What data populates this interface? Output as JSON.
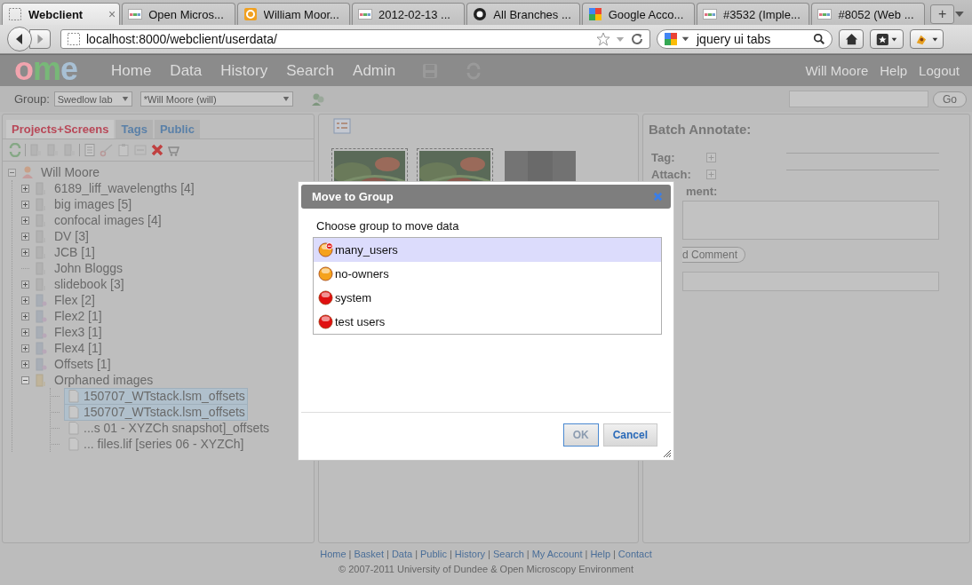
{
  "browser": {
    "tabs": [
      {
        "label": "Webclient",
        "kind": "blank",
        "selected": true
      },
      {
        "label": "Open Micros...",
        "kind": "ome",
        "selected": false
      },
      {
        "label": "William Moor...",
        "kind": "mail",
        "selected": false
      },
      {
        "label": "2012-02-13 ...",
        "kind": "ome",
        "selected": false
      },
      {
        "label": "All Branches ...",
        "kind": "github",
        "selected": false
      },
      {
        "label": "Google Acco...",
        "kind": "google",
        "selected": false
      },
      {
        "label": "#3532 (Imple...",
        "kind": "ome",
        "selected": false
      },
      {
        "label": "#8052 (Web ...",
        "kind": "ome",
        "selected": false
      }
    ],
    "tab_close": "×",
    "new_tab": "+",
    "address": "localhost:8000/webclient/userdata/",
    "search": {
      "value": "jquery ui tabs"
    }
  },
  "header": {
    "logo": [
      {
        "text": "o",
        "color": "#f2a4ae"
      },
      {
        "text": "m",
        "color": "#78b878"
      },
      {
        "text": "e",
        "color": "#a8c0d4"
      }
    ],
    "nav": [
      "Home",
      "Data",
      "History",
      "Search",
      "Admin"
    ],
    "user_links": [
      "Will Moore",
      "Help",
      "Logout"
    ]
  },
  "group_bar": {
    "label": "Group:",
    "group": "Swedlow lab",
    "user": "*Will Moore (will)",
    "go": "Go"
  },
  "left_panel": {
    "tabs": [
      {
        "label": "Projects+Screens",
        "selected": true
      },
      {
        "label": "Tags",
        "selected": false
      },
      {
        "label": "Public",
        "selected": false
      }
    ],
    "tree": {
      "label": "Will Moore",
      "expanded": true,
      "children": [
        {
          "label": "6189_liff_wavelengths [4]",
          "kind": "project",
          "has_children": true,
          "expanded": false,
          "selected": false
        },
        {
          "label": "big images [5]",
          "kind": "project",
          "has_children": true,
          "expanded": false,
          "selected": false
        },
        {
          "label": "confocal images [4]",
          "kind": "project",
          "has_children": true,
          "expanded": false,
          "selected": false
        },
        {
          "label": "DV [3]",
          "kind": "project",
          "has_children": true,
          "expanded": false,
          "selected": false
        },
        {
          "label": "JCB [1]",
          "kind": "project",
          "has_children": true,
          "expanded": false,
          "selected": false
        },
        {
          "label": "John Bloggs",
          "kind": "project",
          "has_children": false,
          "selected": false
        },
        {
          "label": "slidebook [3]",
          "kind": "project",
          "has_children": true,
          "expanded": false,
          "selected": false
        },
        {
          "label": "Flex [2]",
          "kind": "screen",
          "has_children": true,
          "expanded": false,
          "selected": false
        },
        {
          "label": "Flex2 [1]",
          "kind": "screen",
          "has_children": true,
          "expanded": false,
          "selected": false
        },
        {
          "label": "Flex3 [1]",
          "kind": "screen",
          "has_children": true,
          "expanded": false,
          "selected": false
        },
        {
          "label": "Flex4 [1]",
          "kind": "screen",
          "has_children": true,
          "expanded": false,
          "selected": false
        },
        {
          "label": "Offsets [1]",
          "kind": "screen",
          "has_children": true,
          "expanded": false,
          "selected": false
        },
        {
          "label": "Orphaned images",
          "kind": "orphaned",
          "has_children": true,
          "expanded": true,
          "selected": false,
          "children": [
            {
              "label": "150707_WTstack.lsm_offsets",
              "selected": true
            },
            {
              "label": "150707_WTstack.lsm_offsets",
              "selected": true
            },
            {
              "label": "...s 01 - XYZCh snapshot]_offsets",
              "selected": false
            },
            {
              "label": "... files.lif [series 06 - XYZCh]",
              "selected": false
            }
          ]
        }
      ]
    }
  },
  "center_panel": {
    "thumbnails": [
      {
        "kind": "picture",
        "selected": true
      },
      {
        "kind": "picture",
        "selected": true
      },
      {
        "kind": "picture",
        "selected": false
      }
    ]
  },
  "right_panel": {
    "title": "Batch Annotate:",
    "fields": [
      {
        "label": "Tag:"
      },
      {
        "label": "Attach:"
      }
    ],
    "comment_label": "ment:",
    "comment_button": "d Comment"
  },
  "dialog": {
    "title": "Move to Group",
    "prompt": "Choose group to move data",
    "groups": [
      {
        "name": "many_users",
        "color": "#f5a21c",
        "badge": true,
        "selected": true
      },
      {
        "name": "no-owners",
        "color": "#f5a21c",
        "badge": false,
        "selected": false
      },
      {
        "name": "system",
        "color": "#e01010",
        "badge": false,
        "selected": false
      },
      {
        "name": "test users",
        "color": "#e01010",
        "badge": false,
        "selected": false
      }
    ],
    "buttons": [
      {
        "label": "OK",
        "disabled": true,
        "focused": true
      },
      {
        "label": "Cancel",
        "disabled": false,
        "focused": false
      }
    ]
  },
  "footer": {
    "separator": "|",
    "links": [
      "Home",
      "Basket",
      "Data",
      "Public",
      "History",
      "Search",
      "My Account",
      "Help",
      "Contact"
    ],
    "copyright": "© 2007-2011 University of Dundee & Open Microscopy Environment"
  }
}
